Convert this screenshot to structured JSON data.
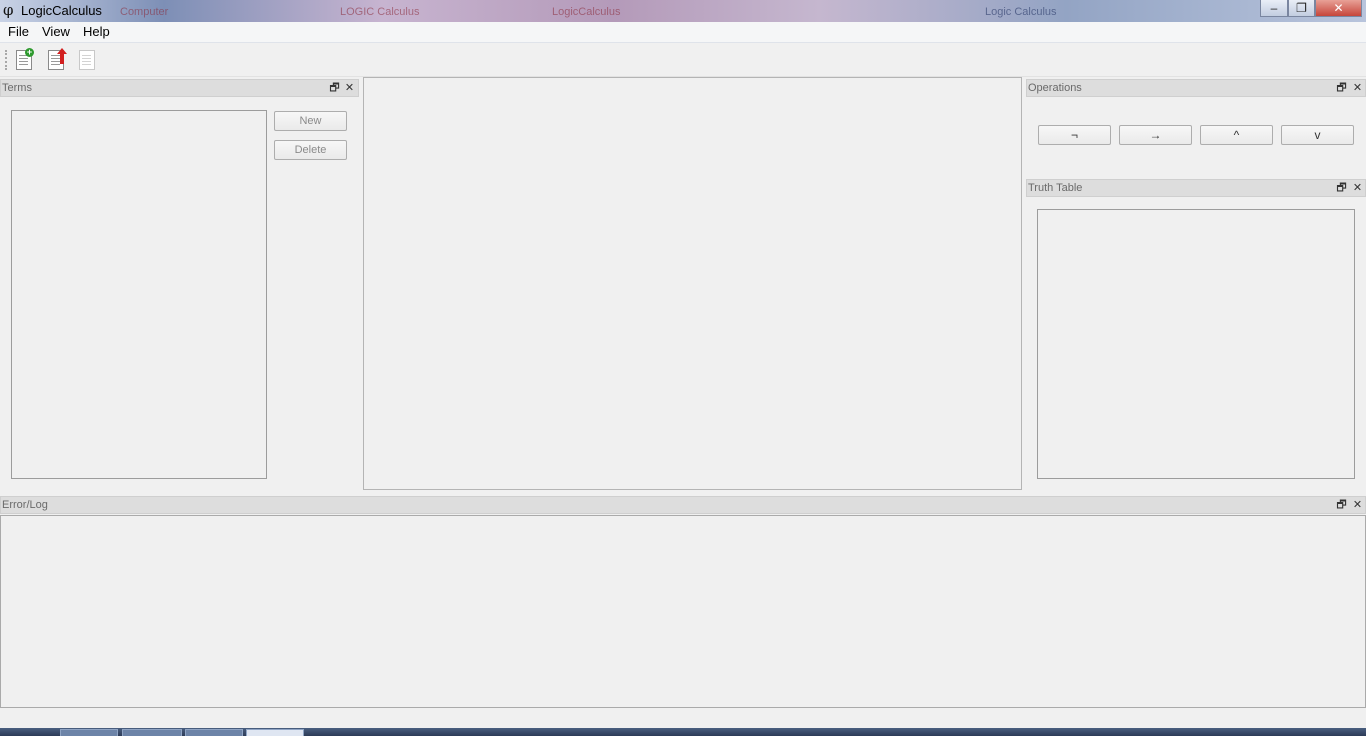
{
  "window": {
    "title": "LogicCalculus",
    "icon": "phi-icon",
    "icon_glyph": "φ",
    "background_tabs": [
      "Computer",
      "LOGIC Calculus",
      "LogicCalculus",
      "Logic Calculus"
    ],
    "controls": {
      "minimize": "–",
      "restore": "❐",
      "close": "✕"
    }
  },
  "menu": {
    "file": "File",
    "view": "View",
    "help": "Help"
  },
  "toolbar": {
    "new_icon": "new-document-icon",
    "export_icon": "export-document-icon",
    "disabled_icon": "document-icon"
  },
  "docks": {
    "float_glyph": "🗗",
    "close_glyph": "✕",
    "terms": {
      "title": "Terms",
      "new_button": "New",
      "delete_button": "Delete"
    },
    "operations": {
      "title": "Operations",
      "buttons": [
        "¬",
        "→",
        "^",
        "v"
      ]
    },
    "truth_table": {
      "title": "Truth Table"
    },
    "error_log": {
      "title": "Error/Log"
    }
  },
  "colors": {
    "accent_red": "#c6453a",
    "dock_title_bg": "#dddddd"
  }
}
